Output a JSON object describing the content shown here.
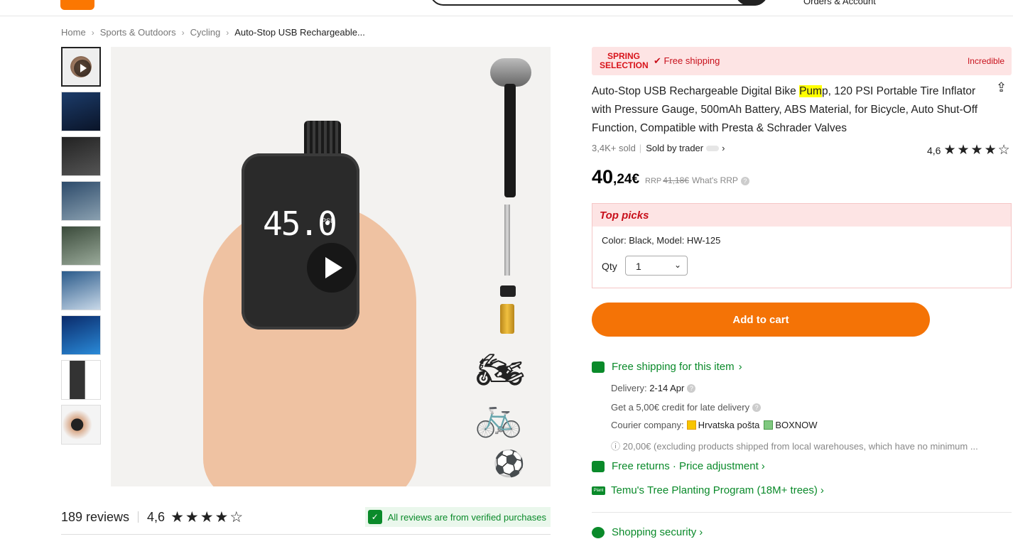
{
  "header": {
    "orders_label": "Orders & Account"
  },
  "breadcrumb": [
    {
      "label": "Home"
    },
    {
      "label": "Sports & Outdoors"
    },
    {
      "label": "Cycling"
    },
    {
      "label": "Auto-Stop USB Rechargeable..."
    }
  ],
  "gallery": {
    "thumbnail_count": 9,
    "active_index": 0,
    "main_screen_value": "45.0",
    "main_screen_unit": "PSI"
  },
  "reviews": {
    "count_label": "189 reviews",
    "score": "4,6",
    "stars": 4.6,
    "verified_text": "All reviews are from verified purchases"
  },
  "promo": {
    "spring_line1": "SPRING",
    "spring_line2": "SELECTION",
    "free_shipping": "Free shipping",
    "right_label": "Incredible"
  },
  "product": {
    "title_before": "Auto-Stop USB Rechargeable Digital Bike ",
    "title_highlight": "Pum",
    "title_after": "p, 120 PSI Portable Tire Inflator with Pressure Gauge, 500mAh Battery, ABS Material, for Bicycle, Auto Shut-Off Function, Compatible with Presta & Schrader Valves",
    "sold": "3,4K+ sold",
    "sold_by": "Sold by trader",
    "rating": "4,6",
    "price_int": "40",
    "price_dec": ",24€",
    "rrp_label": "RRP",
    "rrp_value": "41,18€",
    "whats_rrp": "What's RRP"
  },
  "top_picks": {
    "heading": "Top picks",
    "variant": "Color: Black, Model: HW-125",
    "qty_label": "Qty",
    "qty_value": "1"
  },
  "actions": {
    "add_to_cart": "Add to cart"
  },
  "shipping": {
    "title": "Free shipping for this item",
    "delivery_label": "Delivery:",
    "delivery_value": "2-14 Apr",
    "credit": "Get a 5,00€ credit for late delivery",
    "courier_label": "Courier company:",
    "courier_1": "Hrvatska pošta",
    "courier_2": "BOXNOW",
    "note": "20,00€ (excluding products shipped from local warehouses, which have no minimum ..."
  },
  "returns": {
    "title": "Free returns · Price adjustment"
  },
  "tree": {
    "badge": "Plant",
    "title": "Temu's Tree Planting Program (18M+ trees)"
  },
  "security": {
    "title": "Shopping security"
  },
  "colors": {
    "accent": "#f47306",
    "green": "#0a8a2a",
    "red": "#c8101b",
    "pink_bg": "#fde4e4"
  }
}
